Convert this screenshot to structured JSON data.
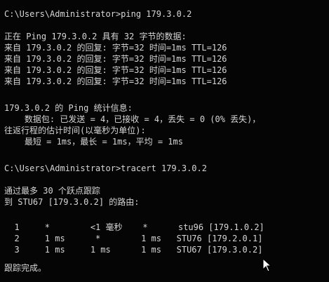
{
  "terminal": {
    "lines": [
      "C:\\Users\\Administrator>ping 179.3.0.2",
      "",
      "正在 Ping 179.3.0.2 具有 32 字节的数据:",
      "来自 179.3.0.2 的回复: 字节=32 时间=1ms TTL=126",
      "来自 179.3.0.2 的回复: 字节=32 时间=1ms TTL=126",
      "来自 179.3.0.2 的回复: 字节=32 时间=1ms TTL=126",
      "来自 179.3.0.2 的回复: 字节=32 时间=1ms TTL=126",
      "",
      "179.3.0.2 的 Ping 统计信息:",
      "    数据包: 已发送 = 4，已接收 = 4，丢失 = 0 (0% 丢失)，",
      "往返行程的估计时间(以毫秒为单位):",
      "    最短 = 1ms，最长 = 1ms，平均 = 1ms",
      "",
      "C:\\Users\\Administrator>tracert 179.3.0.2",
      "",
      "通过最多 30 个跃点跟踪",
      "到 STU67 [179.3.0.2] 的路由:",
      "",
      "  1     *        <1 毫秒    *      stu96 [179.1.0.2]",
      "  2     1 ms      *        1 ms   STU76 [179.2.0.1]",
      "  3     1 ms     1 ms      1 ms   STU67 [179.3.0.2]",
      "",
      "跟踪完成。"
    ]
  }
}
